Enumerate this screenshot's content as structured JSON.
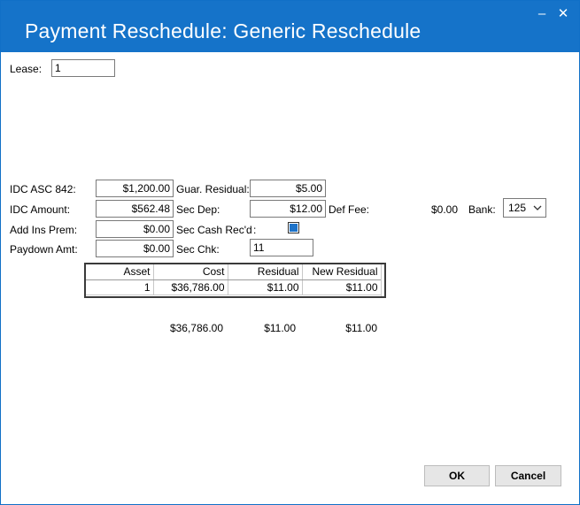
{
  "window": {
    "title": "Payment Reschedule: Generic Reschedule",
    "minimize_glyph": "–",
    "close_glyph": "✕"
  },
  "lease": {
    "label": "Lease:",
    "value": "1"
  },
  "fields": {
    "idc_asc_842": {
      "label": "IDC ASC 842:",
      "value": "$1,200.00"
    },
    "idc_amount": {
      "label": "IDC Amount:",
      "value": "$562.48"
    },
    "add_ins_prem": {
      "label": "Add Ins Prem:",
      "value": "$0.00"
    },
    "paydown_amt": {
      "label": "Paydown Amt:",
      "value": "$0.00"
    },
    "guar_residual": {
      "label": "Guar. Residual:",
      "value": "$5.00"
    },
    "sec_dep": {
      "label": "Sec Dep:",
      "value": "$12.00"
    },
    "sec_cash_recd": {
      "label": "Sec Cash Rec'd",
      "colon": ":",
      "checked": true
    },
    "sec_chk": {
      "label": "Sec Chk:",
      "value": "11"
    },
    "def_fee": {
      "label": "Def Fee:",
      "value": "$0.00"
    },
    "bank": {
      "label": "Bank:",
      "value": "125"
    }
  },
  "grid": {
    "columns": [
      "Asset",
      "Cost",
      "Residual",
      "New Residual"
    ],
    "rows": [
      {
        "asset": "1",
        "cost": "$36,786.00",
        "residual": "$11.00",
        "new_residual": "$11.00"
      }
    ],
    "totals": {
      "cost": "$36,786.00",
      "residual": "$11.00",
      "new_residual": "$11.00"
    }
  },
  "buttons": {
    "ok": "OK",
    "cancel": "Cancel"
  },
  "colors": {
    "titlebar": "#1573c9",
    "checkbox_fill": "#1e73c9"
  },
  "icons": {
    "minimize": "minimize-icon",
    "close": "close-icon",
    "dropdown": "chevron-down-icon"
  }
}
